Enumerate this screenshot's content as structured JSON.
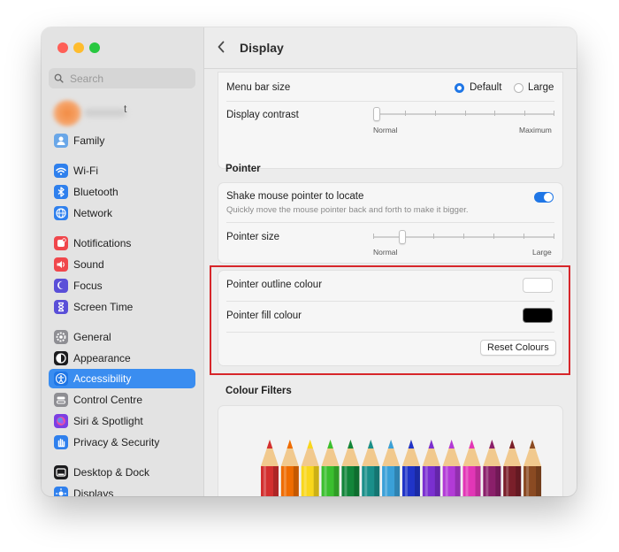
{
  "sidebar": {
    "search_placeholder": "Search",
    "account_partial_text": "t",
    "items": [
      {
        "label": "Family",
        "icon": "family-icon",
        "color": "#6aa7e8"
      },
      {
        "label": "Wi-Fi",
        "icon": "wifi-icon",
        "color": "#2f80ed"
      },
      {
        "label": "Bluetooth",
        "icon": "bluetooth-icon",
        "color": "#2f80ed"
      },
      {
        "label": "Network",
        "icon": "globe-icon",
        "color": "#2f80ed"
      },
      {
        "label": "Notifications",
        "icon": "bell-icon",
        "color": "#f0474c"
      },
      {
        "label": "Sound",
        "icon": "speaker-icon",
        "color": "#f0474c"
      },
      {
        "label": "Focus",
        "icon": "moon-icon",
        "color": "#5a4fd8"
      },
      {
        "label": "Screen Time",
        "icon": "hourglass-icon",
        "color": "#5a4fd8"
      },
      {
        "label": "General",
        "icon": "gear-icon",
        "color": "#8e8e93"
      },
      {
        "label": "Appearance",
        "icon": "appearance-icon",
        "color": "#1c1c1e"
      },
      {
        "label": "Accessibility",
        "icon": "accessibility-icon",
        "color": "#1f76e6"
      },
      {
        "label": "Control Centre",
        "icon": "control-centre-icon",
        "color": "#8e8e93"
      },
      {
        "label": "Siri & Spotlight",
        "icon": "siri-icon",
        "color": "#7b3fe4"
      },
      {
        "label": "Privacy & Security",
        "icon": "hand-icon",
        "color": "#2f80ed"
      },
      {
        "label": "Desktop & Dock",
        "icon": "dock-icon",
        "color": "#1c1c1e"
      },
      {
        "label": "Displays",
        "icon": "displays-icon",
        "color": "#2f80ed"
      }
    ],
    "active": "Accessibility"
  },
  "header": {
    "title": "Display"
  },
  "display_card": {
    "menu_bar_size": "Menu bar size",
    "option_default": "Default",
    "option_large": "Large",
    "selected": "Default",
    "display_contrast": "Display contrast",
    "contrast_min": "Normal",
    "contrast_max": "Maximum",
    "contrast_value": 0.0
  },
  "pointer": {
    "section_title": "Pointer",
    "shake_label": "Shake mouse pointer to locate",
    "shake_desc": "Quickly move the mouse pointer back and forth to make it bigger.",
    "shake_enabled": true,
    "size_label": "Pointer size",
    "size_min": "Normal",
    "size_max": "Large",
    "size_value": 0.16
  },
  "pointer_colours": {
    "outline_label": "Pointer outline colour",
    "outline_color": "#ffffff",
    "fill_label": "Pointer fill colour",
    "fill_color": "#000000",
    "reset_label": "Reset Colours"
  },
  "colour_filters": {
    "section_title": "Colour Filters"
  },
  "pencil_colors": [
    "#d32f2f",
    "#ef6c00",
    "#f9d71c",
    "#3bbf2f",
    "#12853a",
    "#1a8f8a",
    "#3aa0d8",
    "#2034c8",
    "#7a2fd0",
    "#b23ad6",
    "#e236b6",
    "#8a1f6a",
    "#7a1f2a",
    "#8a4a22"
  ],
  "accent_color": "#1f76e6",
  "highlight_color": "#d7262a"
}
